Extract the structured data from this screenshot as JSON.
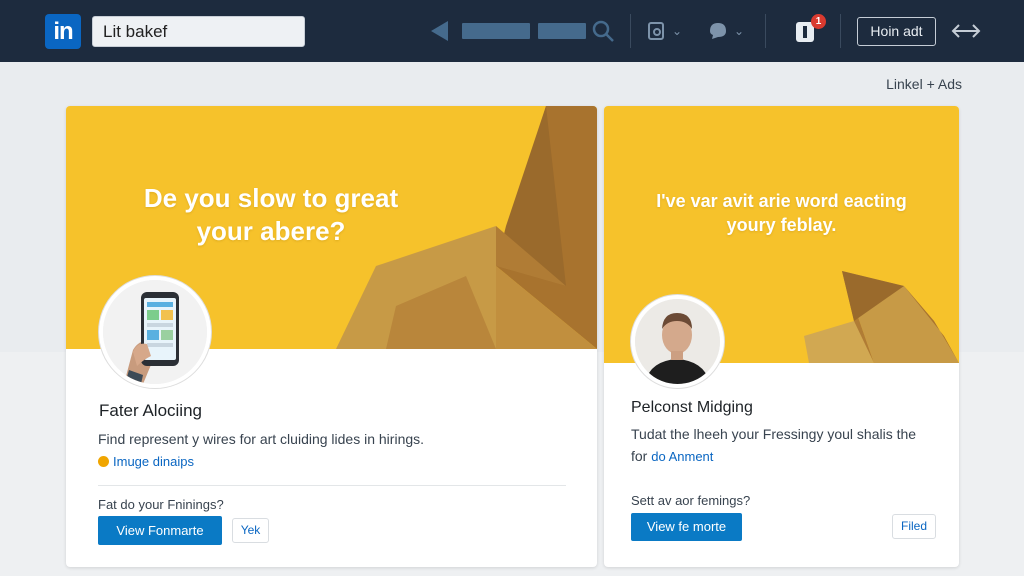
{
  "header": {
    "logo_text": "in",
    "search_value": "Lit bakef",
    "notification_count": "1",
    "home_button_label": "Hoin adt",
    "icons": [
      "linkedin-logo",
      "back-arrow-icon",
      "search-icon",
      "jobs-icon",
      "chat-icon",
      "notifications-icon",
      "expand-icon"
    ]
  },
  "ads_label": "Linkel + Ads",
  "cards": [
    {
      "headline": "De you slow to great your abere?",
      "title": "Fater Alociing",
      "description": "Find represent y wires for art cluiding lides in hirings.",
      "link": "Imuge dinaips",
      "question": "Fat do your Fninings?",
      "primary_button": "View Fonmarte",
      "secondary_button": "Yek"
    },
    {
      "headline": "I've var avit arie word eacting youry feblay.",
      "title": "Pelconst Midging",
      "description": "Tudat the lheeh your Fressingy youl shalis the",
      "description_prefix": "for",
      "link": "do Anment",
      "question": "Sett av aor femings?",
      "primary_button": "View fe morte",
      "secondary_button": "Filed"
    }
  ],
  "colors": {
    "topbar": "#1d2b3e",
    "brand_blue": "#0a66c2",
    "banner_yellow": "#f6c22b",
    "facet_brown": "#b8893a",
    "badge_red": "#d93a2f"
  }
}
